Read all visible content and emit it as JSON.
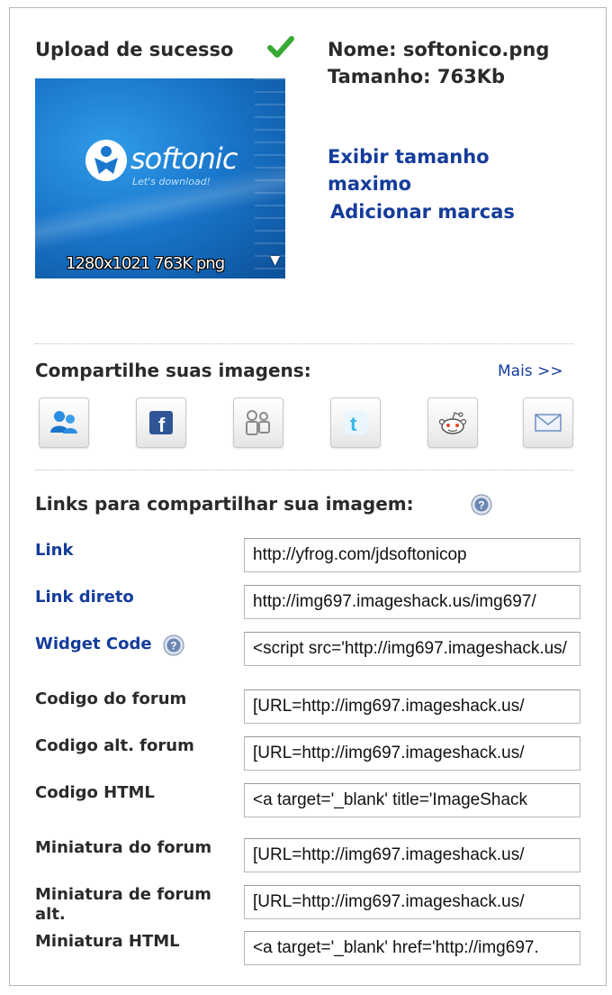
{
  "upload": {
    "title": "Upload de sucesso",
    "thumbnail": {
      "logo_text": "softonic",
      "tagline": "Let's download!",
      "caption": "1280x1021 763K png",
      "arrow": "▼"
    }
  },
  "meta": {
    "name": "Nome: softonico.png",
    "size": "Tamanho: 763Kb",
    "max_size_link": "Exibir tamanho maximo",
    "add_tags_link": "Adicionar marcas"
  },
  "share": {
    "title": "Compartilhe suas imagens:",
    "more_link": "Mais >>",
    "buttons": [
      {
        "icon": "messenger-icon"
      },
      {
        "icon": "facebook-icon"
      },
      {
        "icon": "myspace-icon"
      },
      {
        "icon": "twitter-icon"
      },
      {
        "icon": "reddit-icon"
      },
      {
        "icon": "email-icon"
      }
    ]
  },
  "links": {
    "title": "Links para compartilhar sua imagem:",
    "rows": [
      {
        "label": "Link",
        "value": "http://yfrog.com/jdsoftonicop"
      },
      {
        "label": "Link direto",
        "value": "http://img697.imageshack.us/img697/"
      },
      {
        "label": "Widget Code",
        "value": "<script src='http://img697.imageshack.us/"
      },
      {
        "label": "Codigo do forum",
        "value": "[URL=http://img697.imageshack.us/"
      },
      {
        "label": "Codigo alt. forum",
        "value": "[URL=http://img697.imageshack.us/"
      },
      {
        "label": "Codigo HTML",
        "value": "<a target='_blank' title='ImageShack"
      },
      {
        "label": "Miniatura do forum",
        "value": "[URL=http://img697.imageshack.us/"
      },
      {
        "label": "Miniatura de forum alt.",
        "value": "[URL=http://img697.imageshack.us/"
      },
      {
        "label": "Miniatura HTML",
        "value": "<a target='_blank' href='http://img697."
      }
    ]
  },
  "colors": {
    "link_blue": "#143c9a",
    "check_green": "#39a935",
    "thumb_blue": "#1a77cc"
  }
}
